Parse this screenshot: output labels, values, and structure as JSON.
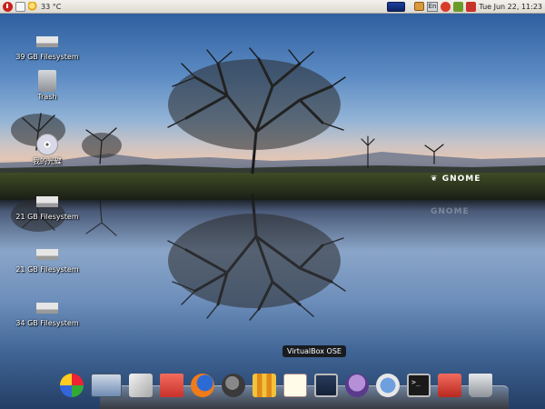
{
  "top_panel": {
    "temperature": "33 °C",
    "keyboard_layout": "En",
    "clock": "Tue Jun 22, 11:23",
    "left_icons": [
      "power-icon",
      "text-editor-icon",
      "weather-icon"
    ],
    "tray_icons": [
      "network-icon",
      "package-icon",
      "keyboard-icon",
      "update-icon",
      "battery-icon",
      "mail-icon"
    ]
  },
  "desktop": {
    "icons": [
      {
        "label": "39 GB Filesystem",
        "icon": "drive-icon"
      },
      {
        "label": "Trash",
        "icon": "trash-icon"
      },
      {
        "label": "我的光碟",
        "icon": "cd-icon"
      },
      {
        "label": "21 GB Filesystem",
        "icon": "drive-icon"
      },
      {
        "label": "21 GB Filesystem",
        "icon": "drive-icon"
      },
      {
        "label": "34 GB Filesystem",
        "icon": "drive-icon"
      }
    ],
    "watermark": "GNOME"
  },
  "dock": {
    "tooltip": "VirtualBox OSE",
    "items": [
      "pinwheel-icon",
      "panel-icon",
      "box-icon",
      "folder-icon",
      "firefox-icon",
      "gimp-icon",
      "chart-icon",
      "notes-icon",
      "virtualbox-icon",
      "pidgin-icon",
      "thunderbird-icon",
      "terminal-icon",
      "folder-red-icon",
      "trash-icon"
    ],
    "terminal_prompt": ">_"
  }
}
